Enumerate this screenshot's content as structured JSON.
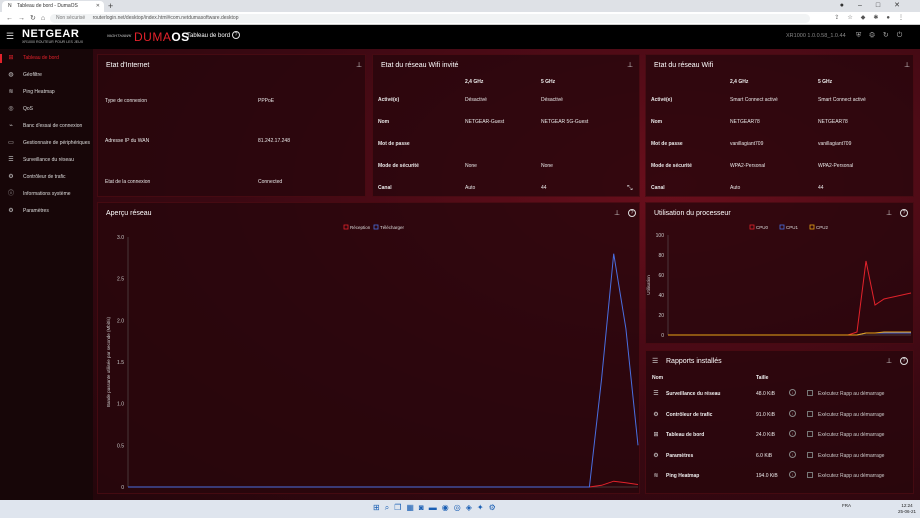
{
  "browser": {
    "tab_title": "Tableau de bord - DumaOS",
    "tab_prefix": "N",
    "new_tab": "+",
    "security": "Non sécurisé",
    "url": "routerlogin.net/desktop/index.html#com.netdumasoftware.desktop"
  },
  "header": {
    "brand": "NETGEAR",
    "brand_sub": "XR1000 ROUTEUR POUR LES JEUX",
    "nighthawk": "NIGHTHAWK",
    "duma_prefix": "DUMA",
    "duma_suffix": "OS",
    "page_title": "Tableau de bord",
    "version": "XR1000 1.0.0.58_1.0.44"
  },
  "sidebar": {
    "items": [
      {
        "label": "Tableau de bord",
        "icon": "dashboard-icon",
        "glyph": "⊞"
      },
      {
        "label": "Géofiltre",
        "icon": "globe-icon",
        "glyph": "◍"
      },
      {
        "label": "Ping Heatmap",
        "icon": "heatmap-icon",
        "glyph": "≋"
      },
      {
        "label": "QoS",
        "icon": "qos-icon",
        "glyph": "◎"
      },
      {
        "label": "Banc d'essai de connexion",
        "icon": "benchmark-icon",
        "glyph": "⌁"
      },
      {
        "label": "Gestionnaire de périphériques",
        "icon": "devices-icon",
        "glyph": "▭"
      },
      {
        "label": "Surveillance du réseau",
        "icon": "network-monitor-icon",
        "glyph": "☰"
      },
      {
        "label": "Contrôleur de trafic",
        "icon": "traffic-icon",
        "glyph": "⚙"
      },
      {
        "label": "Informations système",
        "icon": "info-icon",
        "glyph": "ⓘ"
      },
      {
        "label": "Paramètres",
        "icon": "settings-icon",
        "glyph": "⚙"
      }
    ]
  },
  "internet": {
    "title": "Etat d'Internet",
    "rows": [
      {
        "label": "Type de connexion",
        "value": "PPPoE"
      },
      {
        "label": "Adresse IP du WAN",
        "value": "81.242.17.248"
      },
      {
        "label": "Etat de la connexion",
        "value": "Connected"
      }
    ]
  },
  "guest_wifi": {
    "title": "Etat du réseau Wifi invité",
    "col1": "2,4 GHz",
    "col2": "5 GHz",
    "rows": [
      {
        "label": "Activé(e)",
        "v1": "Désactivé",
        "v2": "Désactivé"
      },
      {
        "label": "Nom",
        "v1": "NETGEAR-Guest",
        "v2": "NETGEAR 5G-Guest"
      },
      {
        "label": "Mot de passe",
        "v1": "",
        "v2": ""
      },
      {
        "label": "Mode de sécurité",
        "v1": "None",
        "v2": "None"
      },
      {
        "label": "Canal",
        "v1": "Auto",
        "v2": "44"
      }
    ]
  },
  "wifi": {
    "title": "Etat du réseau Wifi",
    "col1": "2,4 GHz",
    "col2": "5 GHz",
    "rows": [
      {
        "label": "Activé(e)",
        "v1": "Smart Connect activé",
        "v2": "Smart Connect activé"
      },
      {
        "label": "Nom",
        "v1": "NETGEAR78",
        "v2": "NETGEAR78"
      },
      {
        "label": "Mot de passe",
        "v1": "vanillagiant709",
        "v2": "vanillagiant709"
      },
      {
        "label": "Mode de sécurité",
        "v1": "WPA2-Personal",
        "v2": "WPA2-Personal"
      },
      {
        "label": "Canal",
        "v1": "Auto",
        "v2": "44"
      }
    ]
  },
  "network_panel": {
    "title": "Aperçu réseau"
  },
  "cpu_panel": {
    "title": "Utilisation du processeur"
  },
  "reports": {
    "title": "Rapports installés",
    "col_name": "Nom",
    "col_size": "Taille",
    "checkbox_label": "Exécutez Rapp au démarrage",
    "rows": [
      {
        "name": "Surveillance du réseau",
        "size": "48.0 KiB",
        "glyph": "☰",
        "icon": "network-monitor-icon"
      },
      {
        "name": "Contrôleur de trafic",
        "size": "91.0 KiB",
        "glyph": "⚙",
        "icon": "traffic-icon"
      },
      {
        "name": "Tableau de bord",
        "size": "24.0 KiB",
        "glyph": "⊞",
        "icon": "dashboard-icon"
      },
      {
        "name": "Paramètres",
        "size": "6.0 KiB",
        "glyph": "⚙",
        "icon": "settings-icon"
      },
      {
        "name": "Ping Heatmap",
        "size": "194.0 KiB",
        "glyph": "≋",
        "icon": "heatmap-icon"
      }
    ]
  },
  "taskbar": {
    "lang": "FRA",
    "lang2": "FR",
    "time": "12:24",
    "date": "25-06-21"
  },
  "chart_data": [
    {
      "type": "line",
      "ylabel": "Bande passante utilisée par seconde (Mbit/s)",
      "ylim": [
        0,
        3.0
      ],
      "yticks": [
        "0",
        "0.5",
        "1.0",
        "1.5",
        "2.0",
        "2.5",
        "3.0"
      ],
      "series": [
        {
          "name": "Réception",
          "color": "#e2222b",
          "values": [
            0,
            0,
            0,
            0,
            0,
            0,
            0,
            0,
            0,
            0,
            0,
            0,
            0,
            0,
            0,
            0,
            0,
            0,
            0,
            0,
            0,
            0,
            0,
            0,
            0,
            0,
            0,
            0,
            0,
            0,
            0,
            0,
            0,
            0,
            0,
            0,
            0,
            0,
            0,
            0.02,
            0.07,
            0.05,
            0.03
          ]
        },
        {
          "name": "Télécharger",
          "color": "#4a6ee0",
          "values": [
            0,
            0,
            0,
            0,
            0,
            0,
            0,
            0,
            0,
            0,
            0,
            0,
            0,
            0,
            0,
            0,
            0,
            0,
            0,
            0,
            0,
            0,
            0,
            0,
            0,
            0,
            0,
            0,
            0,
            0,
            0,
            0,
            0,
            0,
            0,
            0,
            0,
            0,
            0,
            1.3,
            2.8,
            1.9,
            0.5
          ]
        }
      ]
    },
    {
      "type": "line",
      "ylabel": "Utilisation",
      "ylim": [
        0,
        100
      ],
      "yticks": [
        "0",
        "20",
        "40",
        "60",
        "80",
        "100"
      ],
      "series": [
        {
          "name": "CPU0",
          "color": "#e2222b",
          "values": [
            0,
            0,
            0,
            0,
            0,
            0,
            0,
            0,
            0,
            0,
            0,
            0,
            0,
            0,
            0,
            0,
            0,
            0,
            0,
            0,
            0,
            3,
            74,
            30,
            36,
            38,
            40,
            42
          ]
        },
        {
          "name": "CPU1",
          "color": "#4a6ee0",
          "values": [
            0,
            0,
            0,
            0,
            0,
            0,
            0,
            0,
            0,
            0,
            0,
            0,
            0,
            0,
            0,
            0,
            0,
            0,
            0,
            0,
            0,
            0,
            2,
            2,
            2,
            2,
            2,
            2
          ]
        },
        {
          "name": "CPU2",
          "color": "#e8a317",
          "values": [
            0,
            0,
            0,
            0,
            0,
            0,
            0,
            0,
            0,
            0,
            0,
            0,
            0,
            0,
            0,
            0,
            0,
            0,
            0,
            0,
            0,
            0,
            2,
            2,
            3,
            3,
            3,
            3
          ]
        }
      ]
    }
  ]
}
